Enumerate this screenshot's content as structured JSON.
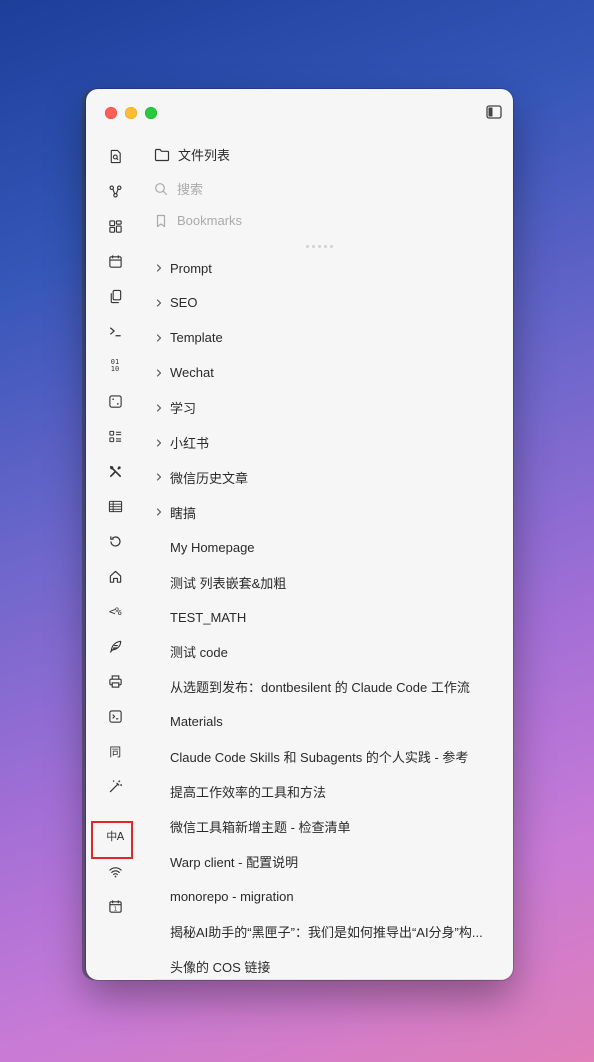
{
  "panel": {
    "header_label": "文件列表",
    "search_placeholder": "搜索",
    "bookmarks_label": "Bookmarks"
  },
  "ribbon_icons": [
    "search-file-icon",
    "graph-icon",
    "grid-icon",
    "calendar-icon",
    "copy-files-icon",
    "terminal-prompt-icon",
    "binary-icon",
    "dice-icon",
    "list-layout-icon",
    "tools-icon",
    "table-icon",
    "history-icon",
    "home-icon",
    "template-code-icon",
    "feather-icon",
    "printer-icon",
    "terminal-box-icon",
    "sync-text-icon",
    "magic-wand-icon",
    "translate-icon",
    "wifi-icon",
    "calendar-day-icon"
  ],
  "ribbon_text": {
    "template_code": "<%",
    "binary_top": "01",
    "binary_bottom": "10",
    "sync_text": "同",
    "translate_text": "中A",
    "calendar_day": "1"
  },
  "folders": [
    {
      "label": "Prompt"
    },
    {
      "label": "SEO"
    },
    {
      "label": "Template"
    },
    {
      "label": "Wechat"
    },
    {
      "label": "学习"
    },
    {
      "label": "小红书"
    },
    {
      "label": "微信历史文章"
    },
    {
      "label": "瞎搞"
    }
  ],
  "files": [
    {
      "label": "My Homepage"
    },
    {
      "label": "测试 列表嵌套&加粗"
    },
    {
      "label": "TEST_MATH"
    },
    {
      "label": "测试 code"
    },
    {
      "label": "从选题到发布：dontbesilent 的 Claude Code 工作流"
    },
    {
      "label": "Materials"
    },
    {
      "label": "Claude Code Skills 和 Subagents 的个人实践 - 参考"
    },
    {
      "label": "提高工作效率的工具和方法"
    },
    {
      "label": "微信工具箱新增主题 - 检查清单"
    },
    {
      "label": "Warp client - 配置说明"
    },
    {
      "label": "monorepo - migration"
    },
    {
      "label": "揭秘AI助手的“黑匣子”：我们是如何推导出“AI分身”构..."
    },
    {
      "label": "头像的 COS 链接"
    }
  ],
  "colors": {
    "window_bg": "#f6f6f6",
    "highlight_border": "#e2272b",
    "close": "#fe5f57",
    "minimize": "#febc2e",
    "maximize": "#28c840"
  }
}
